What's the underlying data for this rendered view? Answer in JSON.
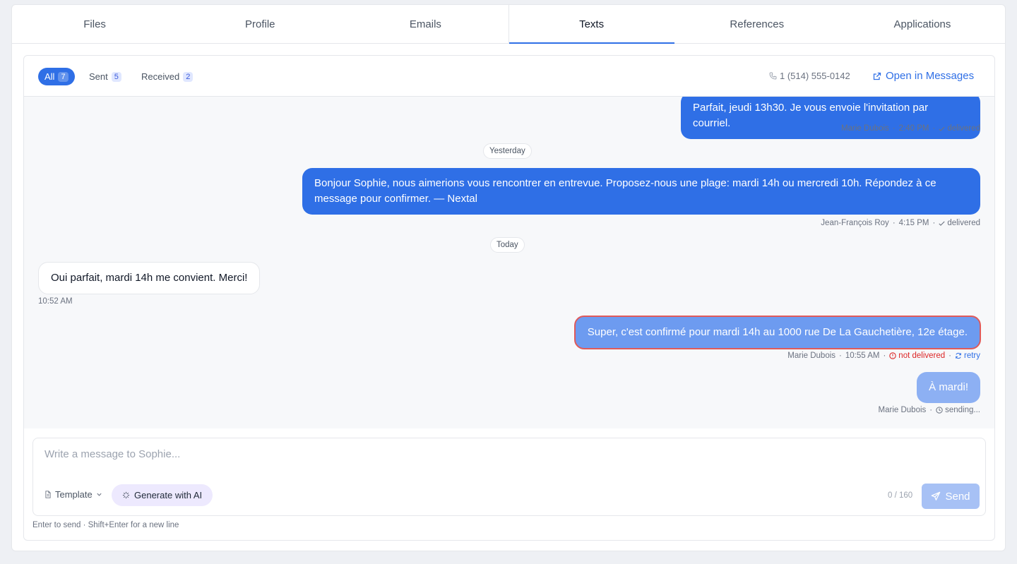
{
  "tabs": [
    {
      "label": "Files"
    },
    {
      "label": "Profile"
    },
    {
      "label": "Emails"
    },
    {
      "label": "Texts"
    },
    {
      "label": "References"
    },
    {
      "label": "Applications"
    }
  ],
  "active_tab": "Texts",
  "filters": [
    {
      "label": "All",
      "count": "7"
    },
    {
      "label": "Sent",
      "count": "5"
    },
    {
      "label": "Received",
      "count": "2"
    }
  ],
  "phone": "1 (514) 555-0142",
  "open_in_messages": "Open in Messages",
  "sep": "·",
  "messages": [
    {
      "text": "Parfait, jeudi 13h30. Je vous envoie l'invitation par courriel.",
      "author": "Marie Dubois",
      "time": "2:40 PM",
      "status": "delivered"
    },
    {
      "text": "Bonjour Sophie, nous aimerions vous rencontrer en entrevue. Proposez-nous une plage: mardi 14h ou mercredi 10h. Répondez à ce message pour confirmer. — Nextal",
      "author": "Jean-François Roy",
      "time": "4:15 PM",
      "status": "delivered"
    },
    {
      "text": "Oui parfait, mardi 14h me convient. Merci!",
      "time": "10:52 AM"
    },
    {
      "text": "Super, c'est confirmé pour mardi 14h au 1000 rue De La Gauchetière, 12e étage.",
      "author": "Marie Dubois",
      "time": "10:55 AM",
      "status": "not delivered",
      "action": "retry"
    },
    {
      "text": "À mardi!",
      "author": "Marie Dubois",
      "status": "sending..."
    }
  ],
  "day_labels": {
    "yesterday": "Yesterday",
    "today": "Today"
  },
  "composer": {
    "placeholder": "Write a message to Sophie...",
    "value": "",
    "template_label": "Template",
    "ai_label": "Generate with AI",
    "counter": "0 / 160",
    "send_label": "Send",
    "hint": "Enter to send · Shift+Enter for a new line"
  },
  "colors": {
    "accent": "#2f6fe6",
    "error": "#dc2626",
    "ai_bg": "#ede9fe"
  }
}
